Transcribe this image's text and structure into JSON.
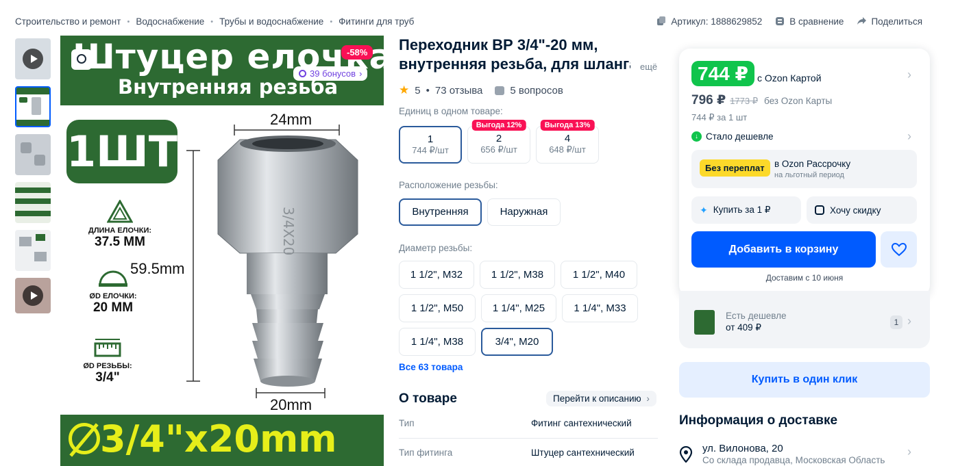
{
  "breadcrumb": [
    "Строительство и ремонт",
    "Водоснабжение",
    "Трубы и водоснабжение",
    "Фитинги для труб"
  ],
  "top_actions": {
    "article": "Артикул: 1888629852",
    "compare": "В сравнение",
    "share": "Поделиться"
  },
  "gallery": {
    "thumb_count": 6,
    "badge_sale": "-58%",
    "badge_bonus": "39 бонусов",
    "image_text": {
      "headline": "Штуцер елочка ВР",
      "subline": "Внутренняя резьба",
      "pcs": "1ШТ",
      "spec1_label": "ДЛИНА ЕЛОЧКИ:",
      "spec1_value": "37.5 MM",
      "spec2_label": "ØD ЕЛОЧКИ:",
      "spec2_value": "20 MM",
      "spec3_label": "ØD РЕЗЬБЫ:",
      "spec3_value": "3/4\"",
      "dim_top": "24mm",
      "dim_height": "59.5mm",
      "dim_bottom": "20mm",
      "bottom_size": "3/4\"x20mm"
    }
  },
  "product": {
    "title_line1": "Переходник ВР 3/4\"-20 мм,",
    "title_line2": "внутренняя резьба, для шланга",
    "more": "ещё",
    "rating": "5",
    "reviews": "73 отзыва",
    "questions": "5 вопросов"
  },
  "units": {
    "label": "Единиц в одном товаре:",
    "options": [
      {
        "qty": "1",
        "price": "744 ₽/шт",
        "promo": ""
      },
      {
        "qty": "2",
        "price": "656 ₽/шт",
        "promo": "Выгода 12%"
      },
      {
        "qty": "4",
        "price": "648 ₽/шт",
        "promo": "Выгода 13%"
      }
    ]
  },
  "thread_position": {
    "label": "Расположение резьбы:",
    "options": [
      "Внутренняя",
      "Наружная"
    ]
  },
  "diameter": {
    "label": "Диаметр резьбы:",
    "options": [
      "1 1/2\", M32",
      "1 1/2\", M38",
      "1 1/2\", M40",
      "1 1/2\", M50",
      "1 1/4\", M25",
      "1 1/4\", M33",
      "1 1/4\", M38",
      "3/4\", M20"
    ],
    "all_link": "Все 63 товара"
  },
  "about": {
    "title": "О товаре",
    "goto": "Перейти к описанию",
    "rows": [
      {
        "k": "Тип",
        "v": "Фитинг сантехнический"
      },
      {
        "k": "Тип фитинга",
        "v": "Штуцер сантехнический"
      }
    ]
  },
  "buy": {
    "price_card": "744 ₽",
    "price_card_note": "с Ozon Картой",
    "price_regular": "796 ₽",
    "price_old": "1773 ₽",
    "price_regular_note": "без Ozon Карты",
    "per_unit": "744 ₽ за 1 шт",
    "cheaper": "Стало дешевле",
    "installment_badge": "Без переплат",
    "installment_text": "в Ozon Рассрочку",
    "installment_sub": "на льготный период",
    "buy_for_1": "Купить за 1 ₽",
    "want_discount": "Хочу скидку",
    "add_to_cart": "Добавить в корзину",
    "delivery_date": "Доставим с 10 июня",
    "cheaper_offer_label": "Есть дешевле",
    "cheaper_offer_price": "от 409 ₽",
    "cheaper_offer_count": "1",
    "one_click": "Купить в один клик"
  },
  "delivery": {
    "title": "Информация о доставке",
    "address": "ул. Вилонова, 20",
    "address_sub": "Со склада продавца, Московская Область"
  },
  "colors": {
    "accent": "#005bff",
    "price_green": "#10c44c",
    "sale_pink": "#f91155",
    "banner_green": "#2d6a32"
  }
}
